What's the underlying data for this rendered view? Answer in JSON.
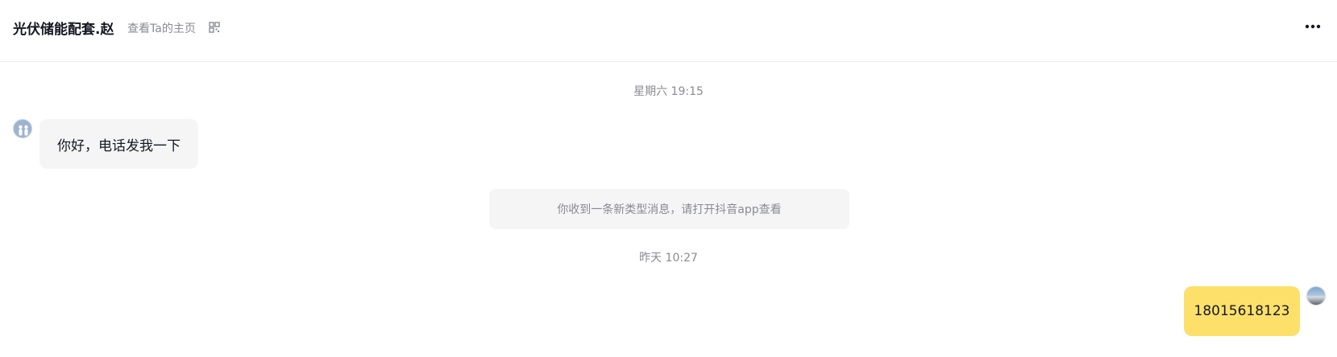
{
  "header": {
    "title": "光伏储能配套.赵",
    "profile_link": "查看Ta的主页",
    "qr_icon": "qr-code-icon",
    "more_icon": "more-horizontal-icon"
  },
  "messages": [
    {
      "type": "timestamp",
      "text": "星期六 19:15"
    },
    {
      "type": "incoming",
      "text": "你好，电话发我一下",
      "avatar": "contact-avatar"
    },
    {
      "type": "system",
      "text": "你收到一条新类型消息，请打开抖音app查看"
    },
    {
      "type": "timestamp",
      "text": "昨天 10:27"
    },
    {
      "type": "outgoing",
      "text": "18015618123",
      "avatar": "own-avatar"
    }
  ],
  "colors": {
    "outgoing_bubble": "#fce06a",
    "incoming_bubble": "#f5f5f5",
    "muted_text": "#8a8b91",
    "primary_text": "#161823"
  }
}
